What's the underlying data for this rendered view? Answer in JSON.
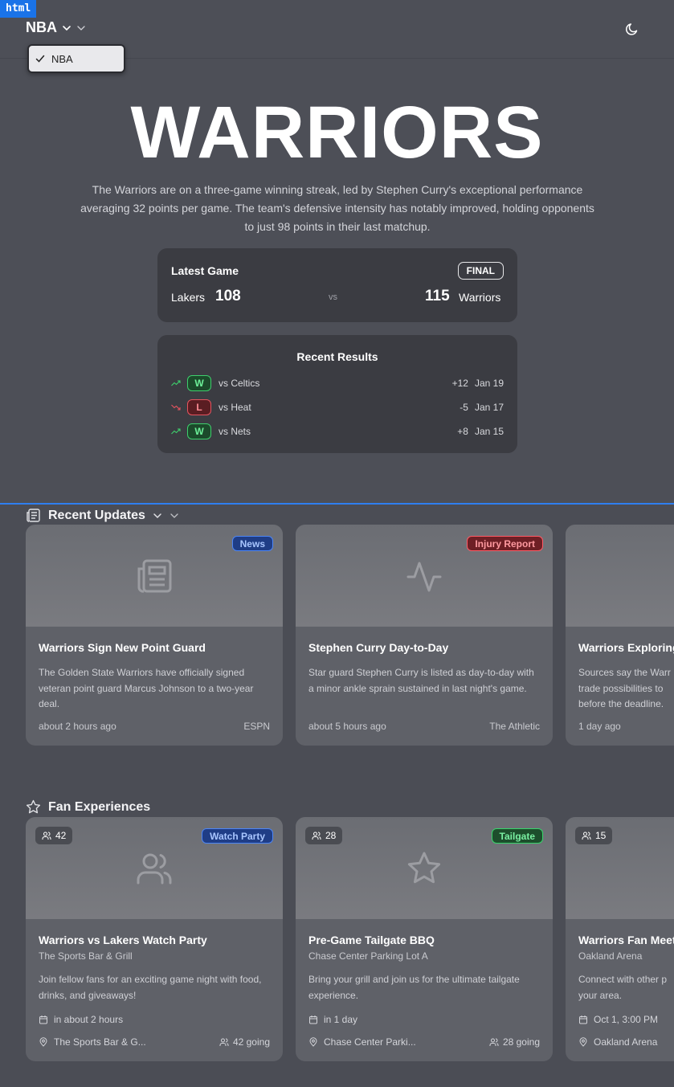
{
  "devtools_tag": "html",
  "header": {
    "league": "NBA",
    "dropdown_options": [
      {
        "label": "NBA",
        "selected": true
      }
    ]
  },
  "hero": {
    "title": "WARRIORS",
    "description": "The Warriors are on a three-game winning streak, led by Stephen Curry's exceptional performance averaging 32 points per game. The team's defensive intensity has notably improved, holding opponents to just 98 points in their last matchup."
  },
  "latest_game": {
    "label": "Latest Game",
    "status": "FINAL",
    "home_team": "Lakers",
    "home_score": "108",
    "vs": "vs",
    "away_score": "115",
    "away_team": "Warriors"
  },
  "recent_results": {
    "title": "Recent Results",
    "rows": [
      {
        "result": "W",
        "opponent": "vs Celtics",
        "diff": "+12",
        "date": "Jan 19",
        "trend": "up"
      },
      {
        "result": "L",
        "opponent": "vs Heat",
        "diff": "-5",
        "date": "Jan 17",
        "trend": "down"
      },
      {
        "result": "W",
        "opponent": "vs Nets",
        "diff": "+8",
        "date": "Jan 15",
        "trend": "up"
      }
    ]
  },
  "updates": {
    "title": "Recent Updates",
    "cards": [
      {
        "tag": "News",
        "title": "Warriors Sign New Point Guard",
        "text": "The Golden State Warriors have officially signed veteran point guard Marcus Johnson to a two-year deal.",
        "time": "about 2 hours ago",
        "source": "ESPN",
        "icon": "newspaper-icon"
      },
      {
        "tag": "Injury Report",
        "title": "Stephen Curry Day-to-Day",
        "text": "Star guard Stephen Curry is listed as day-to-day with a minor ankle sprain sustained in last night's game.",
        "time": "about 5 hours ago",
        "source": "The Athletic",
        "icon": "activity-icon"
      },
      {
        "tag": "",
        "title": "Warriors Exploring",
        "text": "Sources say the Warr trade possibilities to before the deadline.",
        "time": "1 day ago",
        "source": "",
        "icon": ""
      }
    ]
  },
  "fan": {
    "title": "Fan Experiences",
    "cards": [
      {
        "count": "42",
        "tag": "Watch Party",
        "title": "Warriors vs Lakers Watch Party",
        "venue": "The Sports Bar & Grill",
        "text": "Join fellow fans for an exciting game night with food, drinks, and giveaways!",
        "when": "in about 2 hours",
        "location": "The Sports Bar & G...",
        "going": "42 going",
        "icon": "users-icon"
      },
      {
        "count": "28",
        "tag": "Tailgate",
        "title": "Pre-Game Tailgate BBQ",
        "venue": "Chase Center Parking Lot A",
        "text": "Bring your grill and join us for the ultimate tailgate experience.",
        "when": "in 1 day",
        "location": "Chase Center Parki...",
        "going": "28 going",
        "icon": "star-icon"
      },
      {
        "count": "15",
        "tag": "",
        "title": "Warriors Fan Meet",
        "venue": "Oakland Arena",
        "text": "Connect with other p your area.",
        "when": "Oct 1, 3:00 PM",
        "location": "Oakland Arena",
        "going": "",
        "icon": ""
      }
    ]
  },
  "colors": {
    "accent_blue": "#2f7ff0",
    "win": "#3ecf6c",
    "loss": "#e5545f"
  }
}
